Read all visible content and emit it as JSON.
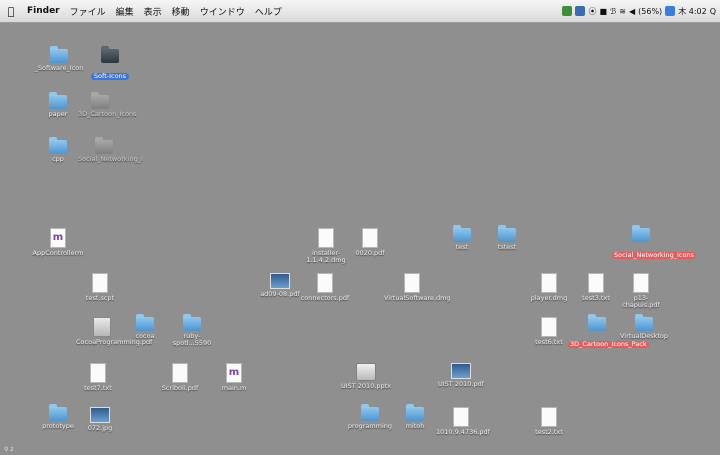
{
  "menubar": {
    "apple": "",
    "app": "Finder",
    "items": [
      "ファイル",
      "編集",
      "表示",
      "移動",
      "ウインドウ",
      "ヘルプ"
    ],
    "status": {
      "volume": "◀",
      "wifi": "",
      "battery": "(56%)",
      "clock": "木 4:02",
      "search": "Q"
    }
  },
  "desktop": {
    "icons": [
      {
        "label": "_Software_Icon",
        "icon": "folder"
      },
      {
        "label": "Soft-Icons",
        "icon": "folder-dark"
      },
      {
        "label": "paper",
        "icon": "folder"
      },
      {
        "label": "3D_Cartoon_Icons",
        "icon": "folder-dim"
      },
      {
        "label": "cpp",
        "icon": "folder"
      },
      {
        "label": "Social_Networking_I",
        "icon": "folder-dim"
      },
      {
        "label": "AppControllerm",
        "icon": "doc-m"
      },
      {
        "label": "installer-1.1.4.2.dmg",
        "icon": "doc"
      },
      {
        "label": "0020.pdf",
        "icon": "doc"
      },
      {
        "label": "test",
        "icon": "folder"
      },
      {
        "label": "tstest",
        "icon": "folder"
      },
      {
        "label": "Social_Networking_Icons",
        "icon": "folder"
      },
      {
        "label": "test.scpt",
        "icon": "doc"
      },
      {
        "label": "ad09-08.pdf",
        "icon": "img"
      },
      {
        "label": "connectors.pdf",
        "icon": "doc"
      },
      {
        "label": "VirtualSoftware.dmg",
        "icon": "doc"
      },
      {
        "label": "player.dmg",
        "icon": "doc"
      },
      {
        "label": "test3.txt",
        "icon": "doc"
      },
      {
        "label": "p13-chapuis.pdf",
        "icon": "doc"
      },
      {
        "label": "CocoaProgramming.pdf",
        "icon": "pdf-mac"
      },
      {
        "label": "cocoa",
        "icon": "folder"
      },
      {
        "label": "ruby-spotl...5590",
        "icon": "folder"
      },
      {
        "label": "test6.txt",
        "icon": "doc"
      },
      {
        "label": "3D_Cartoon_Icons_Pack",
        "icon": "folder"
      },
      {
        "label": "VirtualDesktop",
        "icon": "folder"
      },
      {
        "label": "test7.txt",
        "icon": "doc"
      },
      {
        "label": "Scriboli.pdf",
        "icon": "doc"
      },
      {
        "label": "main.m",
        "icon": "doc-m"
      },
      {
        "label": "UIST 2010.pptx",
        "icon": "dmg"
      },
      {
        "label": "UIST 2010.pdf",
        "icon": "img"
      },
      {
        "label": "prototype",
        "icon": "folder"
      },
      {
        "label": "072.jpg",
        "icon": "img"
      },
      {
        "label": "programming",
        "icon": "folder"
      },
      {
        "label": "mitoh",
        "icon": "folder"
      },
      {
        "label": "1010.9.4736.pdf",
        "icon": "doc"
      },
      {
        "label": "test2.txt",
        "icon": "doc"
      }
    ]
  },
  "footer": "⚲ z"
}
